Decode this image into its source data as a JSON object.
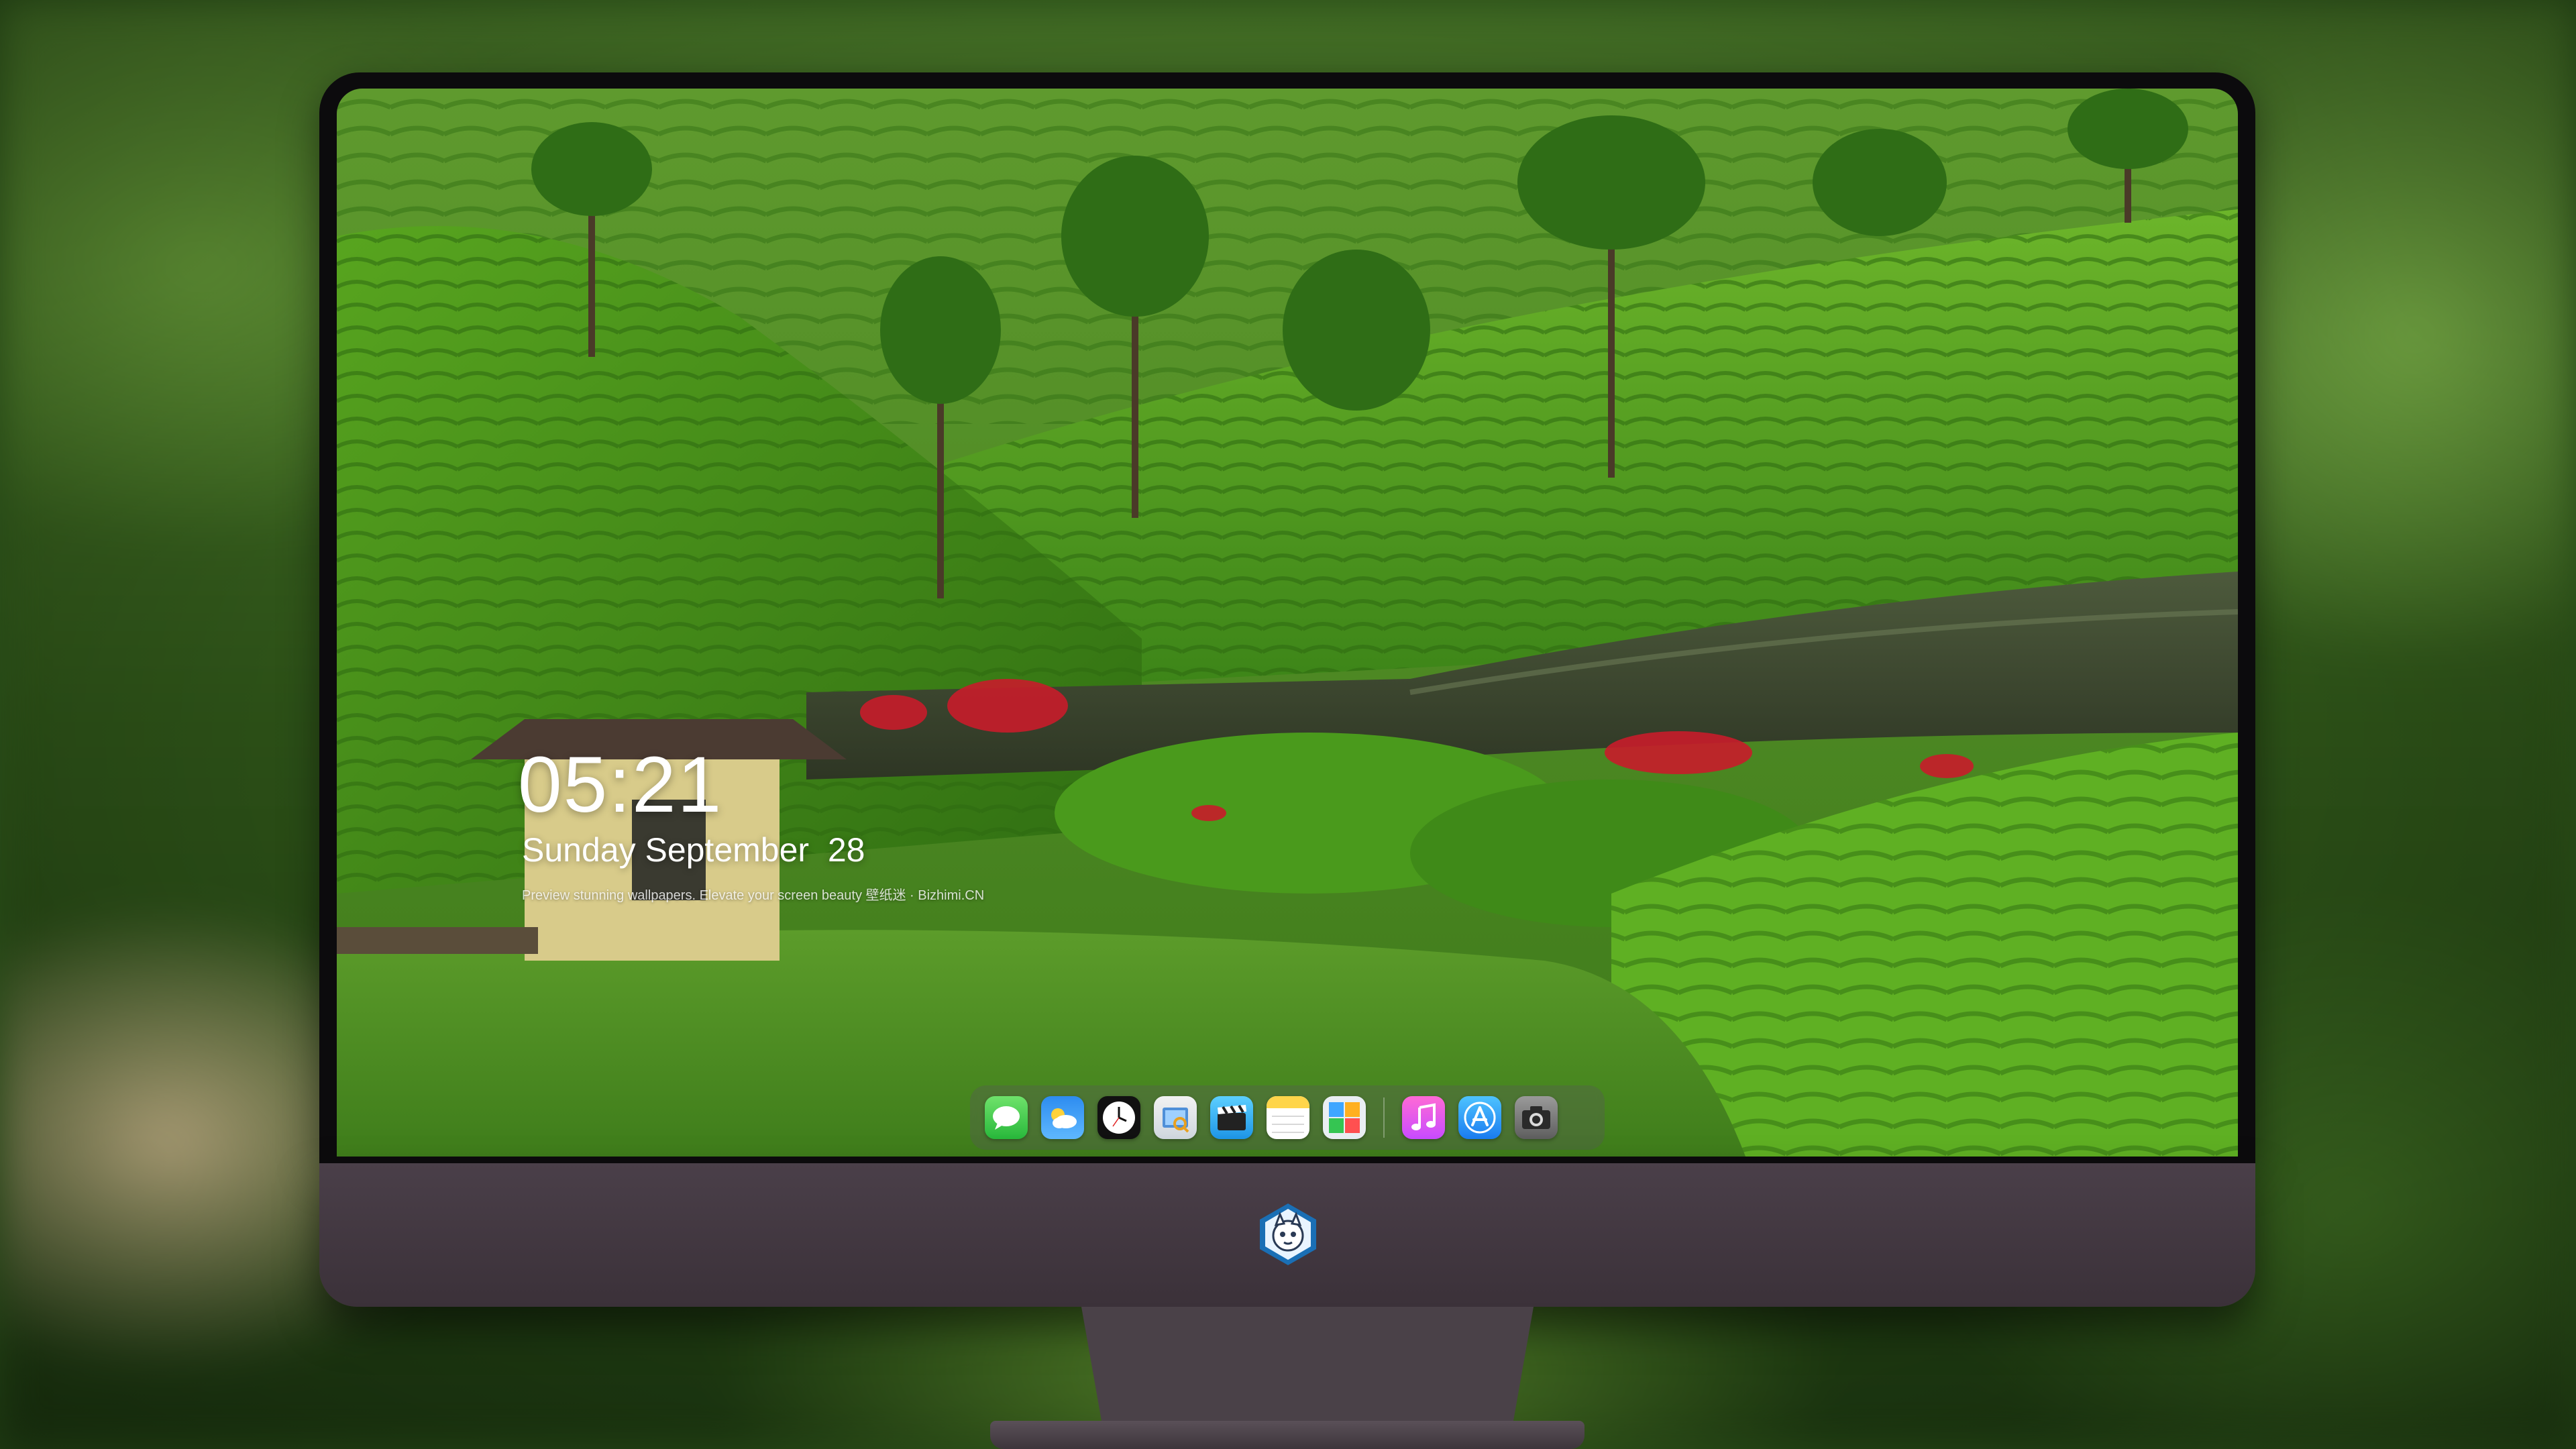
{
  "lockscreen": {
    "time": "05:21",
    "date": "Sunday September  28",
    "caption": "Preview stunning wallpapers. Elevate your screen beauty  壁纸迷 · Bizhimi.CN"
  },
  "dock": {
    "apps": [
      {
        "name": "Messages",
        "icon": "messages-icon"
      },
      {
        "name": "Weather",
        "icon": "weather-icon"
      },
      {
        "name": "Clock",
        "icon": "clock-icon"
      },
      {
        "name": "Preview",
        "icon": "preview-icon"
      },
      {
        "name": "Clips",
        "icon": "clapperboard-icon"
      },
      {
        "name": "Notes",
        "icon": "notes-icon"
      },
      {
        "name": "Photo Booth",
        "icon": "photo-gallery-icon"
      },
      {
        "name": "iTunes",
        "icon": "music-icon"
      },
      {
        "name": "App Store",
        "icon": "app-store-icon"
      },
      {
        "name": "Camera",
        "icon": "camera-icon"
      }
    ]
  },
  "colors": {
    "monitor_chin": "#463c45",
    "bezel": "#0c0b0d",
    "foliage": "#4f9a1c"
  }
}
